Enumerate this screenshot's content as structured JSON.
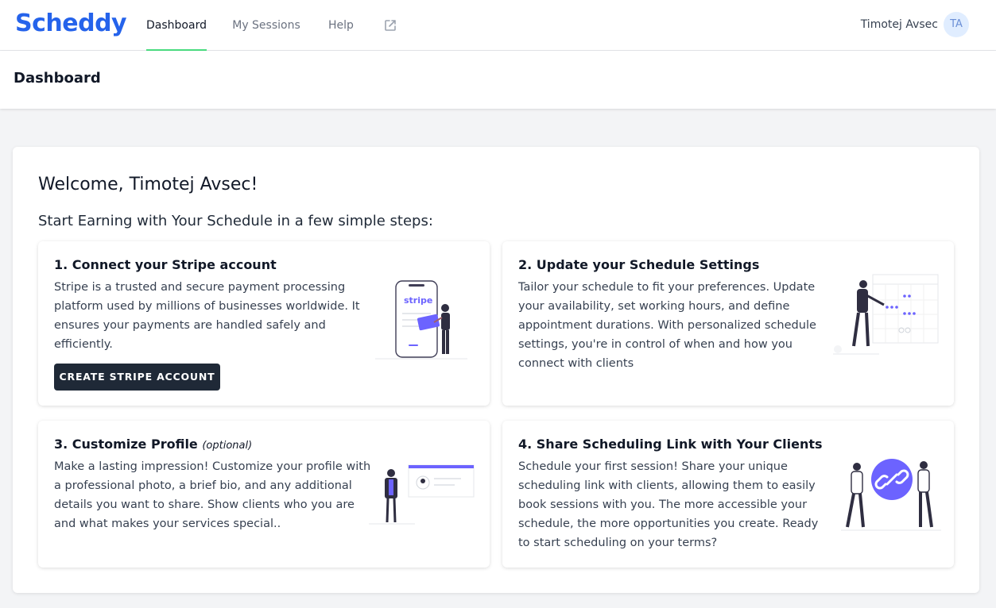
{
  "app": {
    "logo_text": "Scheddy",
    "brand_color": "#2563eb"
  },
  "nav": {
    "items": [
      {
        "label": "Dashboard",
        "active": true
      },
      {
        "label": "My Sessions",
        "active": false
      },
      {
        "label": "Help",
        "active": false
      }
    ],
    "external_icon": "external-link-icon",
    "active_color": "#4ade80"
  },
  "user": {
    "name": "Timotej Avsec",
    "initials": "TA"
  },
  "header": {
    "title": "Dashboard"
  },
  "main": {
    "welcome": "Welcome, Timotej Avsec!",
    "subtitle": "Start Earning with Your Schedule in a few simple steps:",
    "steps": [
      {
        "title": "1. Connect your Stripe account",
        "body": "Stripe is a trusted and secure payment processing platform used by millions of businesses worldwide. It ensures your payments are handled safely and efficiently.",
        "button": "CREATE STRIPE ACCOUNT",
        "illustration": "stripe-phone-illustration",
        "illustration_text": "stripe"
      },
      {
        "title": "2. Update your Schedule Settings",
        "body": "Tailor your schedule to fit your preferences. Update your availability, set working hours, and define appointment durations. With personalized schedule settings, you're in control of when and how you connect with clients",
        "illustration": "schedule-calendar-illustration"
      },
      {
        "title": "3. Customize Profile",
        "title_suffix": "(optional)",
        "body": "Make a lasting impression! Customize your profile with a professional photo, a brief bio, and any additional details you want to share. Show clients who you are and what makes your services special..",
        "illustration": "profile-card-illustration"
      },
      {
        "title": "4. Share Scheduling Link with Your Clients",
        "body": "Schedule your first session! Share your unique scheduling link with clients, allowing them to easily book sessions with you. The more accessible your schedule, the more opportunities you create. Ready to start scheduling on your terms?",
        "illustration": "share-link-illustration"
      }
    ]
  },
  "colors": {
    "illustration_accent": "#6c63ff",
    "button_dark": "#1f2937"
  }
}
